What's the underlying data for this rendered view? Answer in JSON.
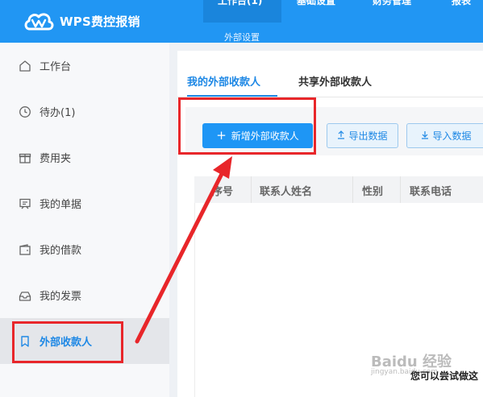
{
  "app": {
    "title": "WPS费控报销"
  },
  "top_nav": {
    "items": [
      "工作台(1)",
      "基础设置",
      "财务管理",
      "报表"
    ],
    "sub_label": "外部设置"
  },
  "sidebar": {
    "items": [
      {
        "label": "工作台",
        "icon": "home-icon"
      },
      {
        "label": "待办(1)",
        "icon": "clock-icon"
      },
      {
        "label": "费用夹",
        "icon": "gift-box-icon"
      },
      {
        "label": "我的单据",
        "icon": "receipt-icon"
      },
      {
        "label": "我的借款",
        "icon": "wallet-icon"
      },
      {
        "label": "我的发票",
        "icon": "invoice-tray-icon"
      },
      {
        "label": "外部收款人",
        "icon": "bookmark-icon",
        "active": true
      }
    ]
  },
  "main": {
    "tabs": [
      {
        "label": "我的外部收款人",
        "active": true
      },
      {
        "label": "共享外部收款人",
        "active": false
      }
    ],
    "buttons": {
      "add": "新增外部收款人",
      "export": "导出数据",
      "import": "导入数据"
    },
    "table": {
      "columns": [
        "序号",
        "联系人姓名",
        "性别",
        "联系电话"
      ]
    }
  },
  "watermark": {
    "brand": "Baidu 经验",
    "url": "jingyan.baidu.com",
    "tip": "您可以尝试做这"
  },
  "colors": {
    "primary": "#2196f3",
    "highlight": "#e8262a"
  }
}
